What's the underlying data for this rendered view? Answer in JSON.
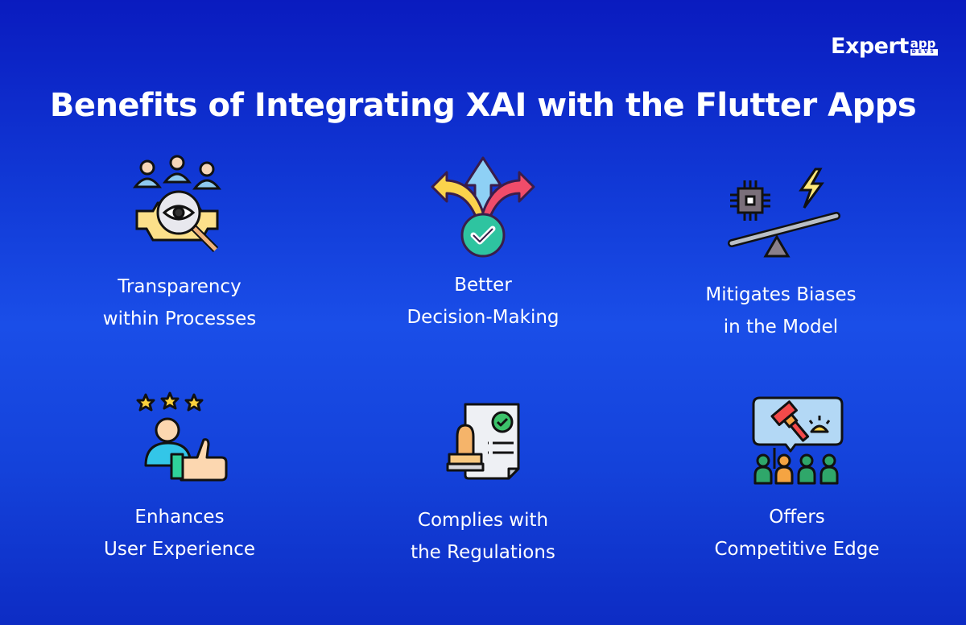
{
  "brand": {
    "name_main": "Expert",
    "name_sup": "app",
    "name_sub": "DEVS"
  },
  "title": "Benefits of Integrating XAI with the Flutter Apps",
  "benefits": [
    {
      "icon": "transparency-icon",
      "line1": "Transparency",
      "line2": "within Processes"
    },
    {
      "icon": "decision-making-icon",
      "line1": "Better",
      "line2": "Decision-Making"
    },
    {
      "icon": "bias-balance-icon",
      "line1": "Mitigates Biases",
      "line2": "in the Model"
    },
    {
      "icon": "user-experience-icon",
      "line1": "Enhances",
      "line2": "User Experience"
    },
    {
      "icon": "regulations-icon",
      "line1": "Complies with",
      "line2": "the Regulations"
    },
    {
      "icon": "competitive-edge-icon",
      "line1": "Offers",
      "line2": "Competitive Edge"
    }
  ],
  "colors": {
    "background_top": "#0a1bbf",
    "background_mid": "#1a4ee8",
    "text": "#ffffff"
  }
}
